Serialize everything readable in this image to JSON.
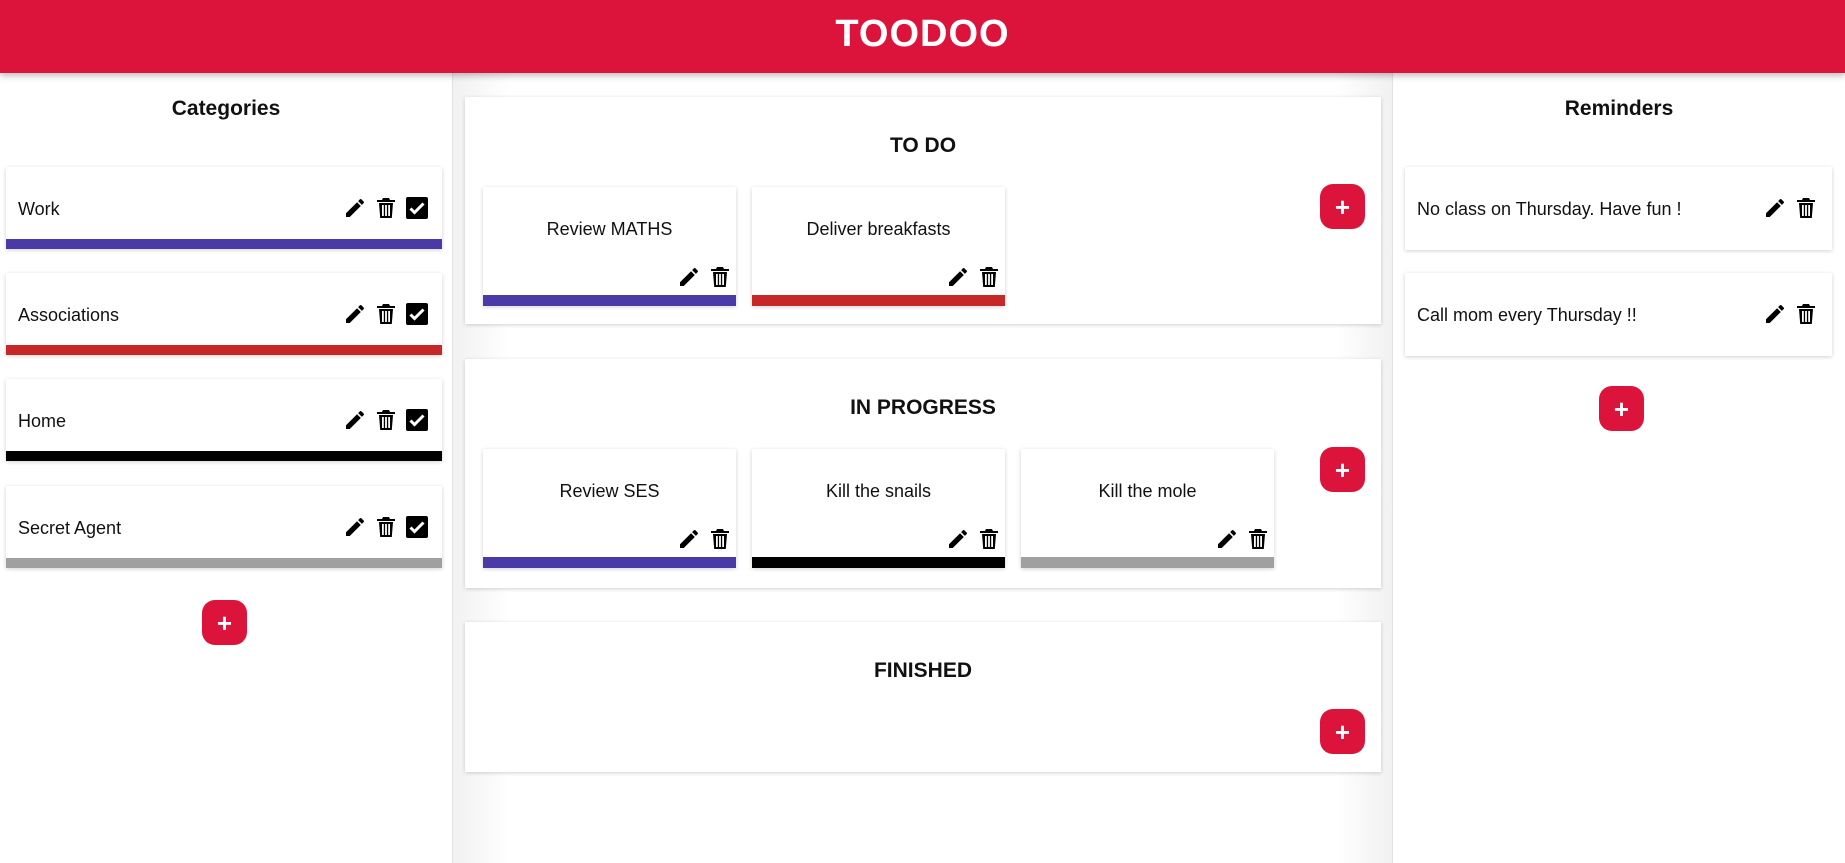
{
  "app": {
    "title": "TOODOO",
    "brand_color": "#dc143c"
  },
  "categories": {
    "title": "Categories",
    "items": [
      {
        "label": "Work",
        "color": "#4a3aa8"
      },
      {
        "label": "Associations",
        "color": "#c62828"
      },
      {
        "label": "Home",
        "color": "#000000"
      },
      {
        "label": "Secret Agent",
        "color": "#a0a0a0"
      }
    ],
    "add_label": "+"
  },
  "board": {
    "columns": [
      {
        "title": "TO DO",
        "add_label": "+",
        "tasks": [
          {
            "label": "Review MATHS",
            "color": "#4a3aa8"
          },
          {
            "label": "Deliver breakfasts",
            "color": "#c62828"
          }
        ]
      },
      {
        "title": "IN PROGRESS",
        "add_label": "+",
        "tasks": [
          {
            "label": "Review SES",
            "color": "#4a3aa8"
          },
          {
            "label": "Kill the snails",
            "color": "#000000"
          },
          {
            "label": "Kill the mole",
            "color": "#a0a0a0"
          }
        ]
      },
      {
        "title": "FINISHED",
        "add_label": "+",
        "tasks": []
      }
    ]
  },
  "reminders": {
    "title": "Reminders",
    "items": [
      {
        "text": "No class on Thursday. Have fun !"
      },
      {
        "text": "Call mom every Thursday !!"
      }
    ],
    "add_label": "+"
  },
  "icons": {
    "edit": "pencil-icon",
    "delete": "trash-icon",
    "toggle": "checkbox-checked-icon"
  }
}
